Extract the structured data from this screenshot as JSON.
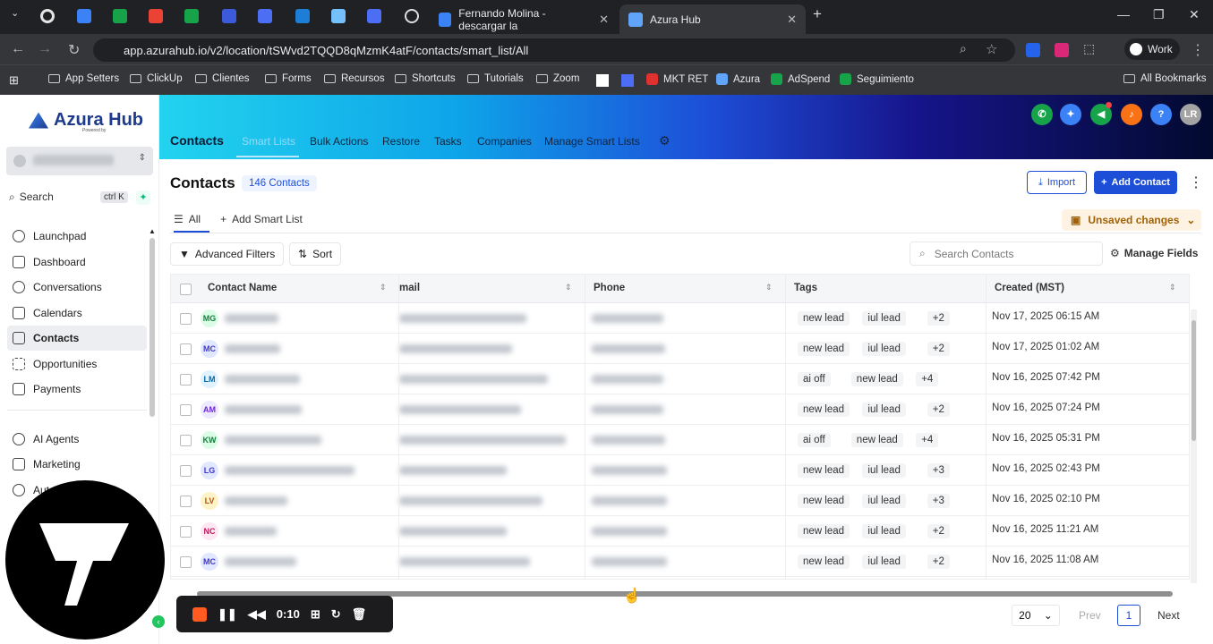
{
  "browser": {
    "tabs": [
      {
        "label": "Fernando Molina - descargar la"
      },
      {
        "label": "Azura Hub"
      }
    ],
    "url": "app.azurahub.io/v2/location/tSWvd2TQQD8qMzmK4atF/contacts/smart_list/All",
    "profile": "Work",
    "bookmarks": [
      "App Setters",
      "ClickUp",
      "Clientes",
      "Forms",
      "Recursos",
      "Shortcuts",
      "Tutorials",
      "Zoom",
      "MKT RET",
      "Azura",
      "AdSpend",
      "Seguimiento",
      "All Bookmarks"
    ]
  },
  "app": {
    "logo": "Azura Hub",
    "logo_sub": "Powered by",
    "search_label": "Search",
    "search_kbd": "ctrl K",
    "user_initials": "LR"
  },
  "nav": [
    "Launchpad",
    "Dashboard",
    "Conversations",
    "Calendars",
    "Contacts",
    "Opportunities",
    "Payments",
    "AI Agents",
    "Marketing",
    "Aut"
  ],
  "topnav": {
    "title": "Contacts",
    "items": [
      "Smart Lists",
      "Bulk Actions",
      "Restore",
      "Tasks",
      "Companies",
      "Manage Smart Lists"
    ]
  },
  "page": {
    "title": "Contacts",
    "count": "146 Contacts",
    "import": "Import",
    "add": "Add Contact",
    "tab_all": "All",
    "tab_add": "Add Smart List",
    "unsaved": "Unsaved changes",
    "advanced": "Advanced Filters",
    "sort": "Sort",
    "search_placeholder": "Search Contacts",
    "manage_fields": "Manage Fields"
  },
  "table": {
    "headers": [
      "Contact Name",
      "mail",
      "Phone",
      "Tags",
      "Created (MST)"
    ],
    "rows": [
      {
        "initials": "MG",
        "av_bg": "#dcfce7",
        "av_fg": "#15803d",
        "tags": [
          "new lead",
          "iul lead",
          "+2"
        ],
        "created": "Nov 17, 2025 06:15 AM"
      },
      {
        "initials": "MC",
        "av_bg": "#e0e7ff",
        "av_fg": "#4338ca",
        "tags": [
          "new lead",
          "iul lead",
          "+2"
        ],
        "created": "Nov 17, 2025 01:02 AM"
      },
      {
        "initials": "LM",
        "av_bg": "#e0f2fe",
        "av_fg": "#0369a1",
        "tags": [
          "ai off",
          "new lead",
          "+4"
        ],
        "created": "Nov 16, 2025 07:42 PM"
      },
      {
        "initials": "AM",
        "av_bg": "#ede9fe",
        "av_fg": "#6d28d9",
        "tags": [
          "new lead",
          "iul lead",
          "+2"
        ],
        "created": "Nov 16, 2025 07:24 PM"
      },
      {
        "initials": "KW",
        "av_bg": "#dcfce7",
        "av_fg": "#15803d",
        "tags": [
          "ai off",
          "new lead",
          "+4"
        ],
        "created": "Nov 16, 2025 05:31 PM"
      },
      {
        "initials": "LG",
        "av_bg": "#e0e7ff",
        "av_fg": "#4338ca",
        "tags": [
          "new lead",
          "iul lead",
          "+3"
        ],
        "created": "Nov 16, 2025 02:43 PM"
      },
      {
        "initials": "LV",
        "av_bg": "#fef3c7",
        "av_fg": "#b45309",
        "tags": [
          "new lead",
          "iul lead",
          "+3"
        ],
        "created": "Nov 16, 2025 02:10 PM"
      },
      {
        "initials": "NC",
        "av_bg": "#fce7f3",
        "av_fg": "#be185d",
        "tags": [
          "new lead",
          "iul lead",
          "+2"
        ],
        "created": "Nov 16, 2025 11:21 AM"
      },
      {
        "initials": "MC",
        "av_bg": "#e0e7ff",
        "av_fg": "#4338ca",
        "tags": [
          "new lead",
          "iul lead",
          "+2"
        ],
        "created": "Nov 16, 2025 11:08 AM"
      }
    ]
  },
  "pagination": {
    "per_page": "20",
    "prev": "Prev",
    "page": "1",
    "next": "Next"
  },
  "recorder": {
    "time": "0:10"
  }
}
